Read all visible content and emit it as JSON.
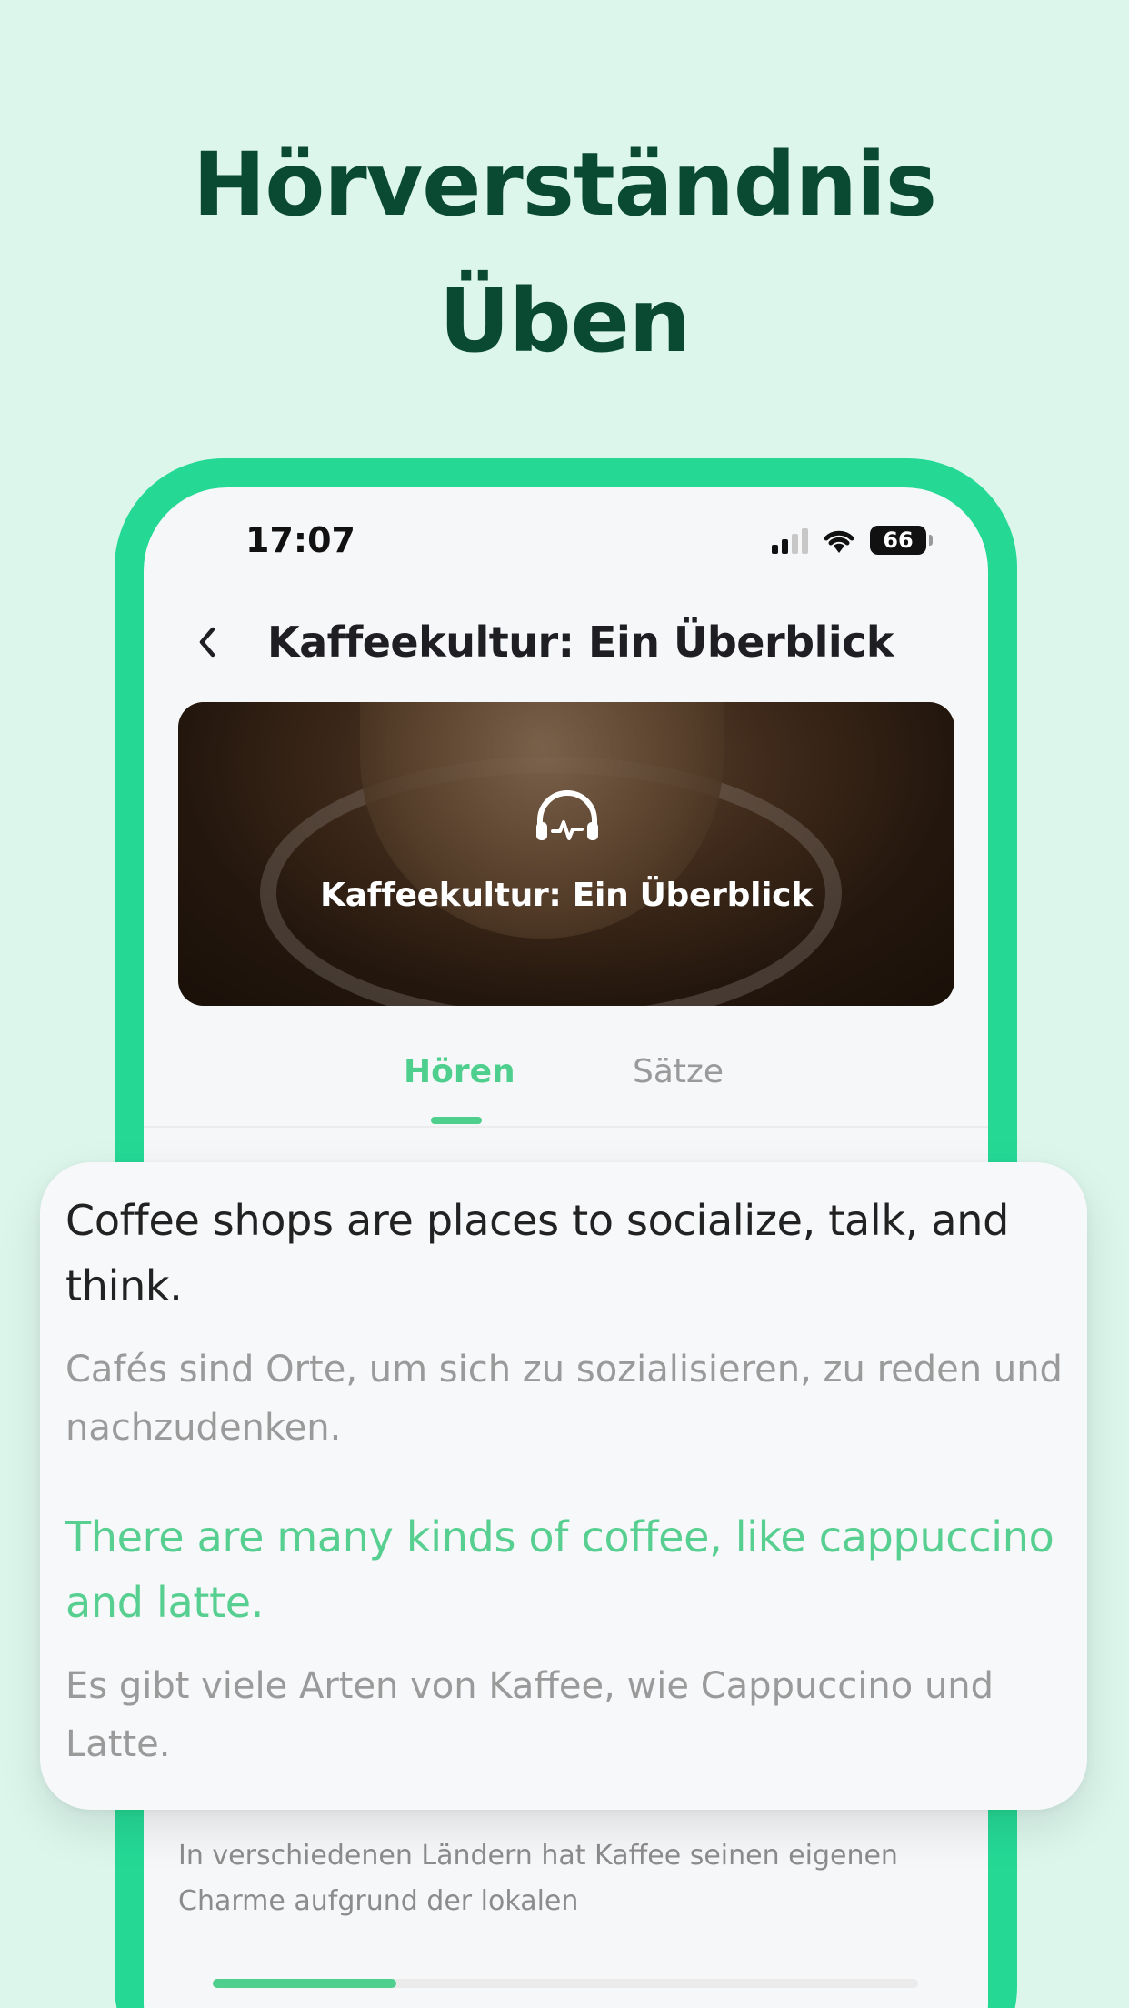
{
  "headline": {
    "line1": "Hörverständnis",
    "line2": "Üben"
  },
  "status_bar": {
    "time": "17:07",
    "battery": "66"
  },
  "nav": {
    "title": "Kaffeekultur: Ein Überblick"
  },
  "banner": {
    "title": "Kaffeekultur: Ein Überblick",
    "icon": "headphones-icon"
  },
  "tabs": [
    {
      "label": "Hören",
      "active": true
    },
    {
      "label": "Sätze",
      "active": false
    }
  ],
  "card": {
    "sentences": [
      {
        "en": "Coffee shops are places to socialize, talk, and think.",
        "de": "Cafés sind Orte, um sich zu sozialisieren, zu reden und nachzudenken.",
        "active": false
      },
      {
        "en": "There are many kinds of coffee, like cappuccino and latte.",
        "de": "Es gibt viele Arten von Kaffee, wie Cappuccino und Latte.",
        "active": true
      }
    ]
  },
  "background_text": "In verschiedenen Ländern hat Kaffee seinen eigenen Charme aufgrund der lokalen",
  "progress": 0.26,
  "colors": {
    "accent": "#4fcf8d",
    "frame": "#25d995",
    "background": "#dcf6ec",
    "headline": "#0b4a32"
  }
}
